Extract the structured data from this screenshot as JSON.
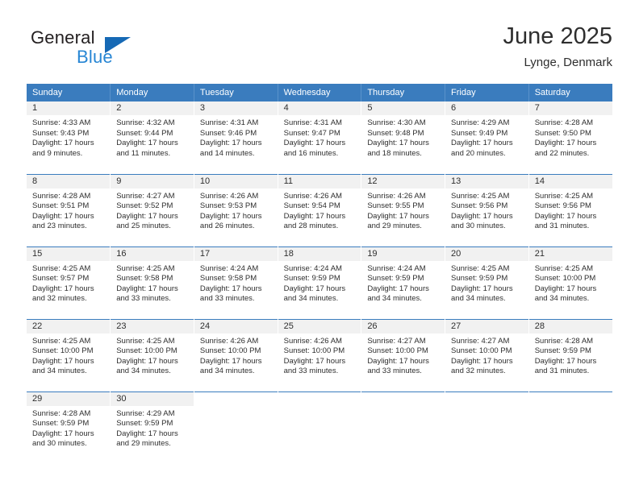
{
  "logo": {
    "word_one": "General",
    "word_two": "Blue",
    "triangle_icon": "blue-triangle-icon",
    "colors": {
      "general": "#231f20",
      "blue": "#2786d4",
      "triangle": "#1669b5"
    }
  },
  "header": {
    "title": "June 2025",
    "subtitle": "Lynge, Denmark"
  },
  "theme": {
    "header_band": "#3a7cbe",
    "daynum_band": "#f1f1f1",
    "text": "#2e2e2e",
    "row_rule": "#3a7cbe"
  },
  "weekday_headers": [
    "Sunday",
    "Monday",
    "Tuesday",
    "Wednesday",
    "Thursday",
    "Friday",
    "Saturday"
  ],
  "labels": {
    "sunrise_prefix": "Sunrise:",
    "sunset_prefix": "Sunset:",
    "daylight_prefix": "Daylight:"
  },
  "weeks": [
    [
      {
        "day": "1",
        "sunrise": "Sunrise: 4:33 AM",
        "sunset": "Sunset: 9:43 PM",
        "daylight_a": "Daylight: 17 hours",
        "daylight_b": "and 9 minutes."
      },
      {
        "day": "2",
        "sunrise": "Sunrise: 4:32 AM",
        "sunset": "Sunset: 9:44 PM",
        "daylight_a": "Daylight: 17 hours",
        "daylight_b": "and 11 minutes."
      },
      {
        "day": "3",
        "sunrise": "Sunrise: 4:31 AM",
        "sunset": "Sunset: 9:46 PM",
        "daylight_a": "Daylight: 17 hours",
        "daylight_b": "and 14 minutes."
      },
      {
        "day": "4",
        "sunrise": "Sunrise: 4:31 AM",
        "sunset": "Sunset: 9:47 PM",
        "daylight_a": "Daylight: 17 hours",
        "daylight_b": "and 16 minutes."
      },
      {
        "day": "5",
        "sunrise": "Sunrise: 4:30 AM",
        "sunset": "Sunset: 9:48 PM",
        "daylight_a": "Daylight: 17 hours",
        "daylight_b": "and 18 minutes."
      },
      {
        "day": "6",
        "sunrise": "Sunrise: 4:29 AM",
        "sunset": "Sunset: 9:49 PM",
        "daylight_a": "Daylight: 17 hours",
        "daylight_b": "and 20 minutes."
      },
      {
        "day": "7",
        "sunrise": "Sunrise: 4:28 AM",
        "sunset": "Sunset: 9:50 PM",
        "daylight_a": "Daylight: 17 hours",
        "daylight_b": "and 22 minutes."
      }
    ],
    [
      {
        "day": "8",
        "sunrise": "Sunrise: 4:28 AM",
        "sunset": "Sunset: 9:51 PM",
        "daylight_a": "Daylight: 17 hours",
        "daylight_b": "and 23 minutes."
      },
      {
        "day": "9",
        "sunrise": "Sunrise: 4:27 AM",
        "sunset": "Sunset: 9:52 PM",
        "daylight_a": "Daylight: 17 hours",
        "daylight_b": "and 25 minutes."
      },
      {
        "day": "10",
        "sunrise": "Sunrise: 4:26 AM",
        "sunset": "Sunset: 9:53 PM",
        "daylight_a": "Daylight: 17 hours",
        "daylight_b": "and 26 minutes."
      },
      {
        "day": "11",
        "sunrise": "Sunrise: 4:26 AM",
        "sunset": "Sunset: 9:54 PM",
        "daylight_a": "Daylight: 17 hours",
        "daylight_b": "and 28 minutes."
      },
      {
        "day": "12",
        "sunrise": "Sunrise: 4:26 AM",
        "sunset": "Sunset: 9:55 PM",
        "daylight_a": "Daylight: 17 hours",
        "daylight_b": "and 29 minutes."
      },
      {
        "day": "13",
        "sunrise": "Sunrise: 4:25 AM",
        "sunset": "Sunset: 9:56 PM",
        "daylight_a": "Daylight: 17 hours",
        "daylight_b": "and 30 minutes."
      },
      {
        "day": "14",
        "sunrise": "Sunrise: 4:25 AM",
        "sunset": "Sunset: 9:56 PM",
        "daylight_a": "Daylight: 17 hours",
        "daylight_b": "and 31 minutes."
      }
    ],
    [
      {
        "day": "15",
        "sunrise": "Sunrise: 4:25 AM",
        "sunset": "Sunset: 9:57 PM",
        "daylight_a": "Daylight: 17 hours",
        "daylight_b": "and 32 minutes."
      },
      {
        "day": "16",
        "sunrise": "Sunrise: 4:25 AM",
        "sunset": "Sunset: 9:58 PM",
        "daylight_a": "Daylight: 17 hours",
        "daylight_b": "and 33 minutes."
      },
      {
        "day": "17",
        "sunrise": "Sunrise: 4:24 AM",
        "sunset": "Sunset: 9:58 PM",
        "daylight_a": "Daylight: 17 hours",
        "daylight_b": "and 33 minutes."
      },
      {
        "day": "18",
        "sunrise": "Sunrise: 4:24 AM",
        "sunset": "Sunset: 9:59 PM",
        "daylight_a": "Daylight: 17 hours",
        "daylight_b": "and 34 minutes."
      },
      {
        "day": "19",
        "sunrise": "Sunrise: 4:24 AM",
        "sunset": "Sunset: 9:59 PM",
        "daylight_a": "Daylight: 17 hours",
        "daylight_b": "and 34 minutes."
      },
      {
        "day": "20",
        "sunrise": "Sunrise: 4:25 AM",
        "sunset": "Sunset: 9:59 PM",
        "daylight_a": "Daylight: 17 hours",
        "daylight_b": "and 34 minutes."
      },
      {
        "day": "21",
        "sunrise": "Sunrise: 4:25 AM",
        "sunset": "Sunset: 10:00 PM",
        "daylight_a": "Daylight: 17 hours",
        "daylight_b": "and 34 minutes."
      }
    ],
    [
      {
        "day": "22",
        "sunrise": "Sunrise: 4:25 AM",
        "sunset": "Sunset: 10:00 PM",
        "daylight_a": "Daylight: 17 hours",
        "daylight_b": "and 34 minutes."
      },
      {
        "day": "23",
        "sunrise": "Sunrise: 4:25 AM",
        "sunset": "Sunset: 10:00 PM",
        "daylight_a": "Daylight: 17 hours",
        "daylight_b": "and 34 minutes."
      },
      {
        "day": "24",
        "sunrise": "Sunrise: 4:26 AM",
        "sunset": "Sunset: 10:00 PM",
        "daylight_a": "Daylight: 17 hours",
        "daylight_b": "and 34 minutes."
      },
      {
        "day": "25",
        "sunrise": "Sunrise: 4:26 AM",
        "sunset": "Sunset: 10:00 PM",
        "daylight_a": "Daylight: 17 hours",
        "daylight_b": "and 33 minutes."
      },
      {
        "day": "26",
        "sunrise": "Sunrise: 4:27 AM",
        "sunset": "Sunset: 10:00 PM",
        "daylight_a": "Daylight: 17 hours",
        "daylight_b": "and 33 minutes."
      },
      {
        "day": "27",
        "sunrise": "Sunrise: 4:27 AM",
        "sunset": "Sunset: 10:00 PM",
        "daylight_a": "Daylight: 17 hours",
        "daylight_b": "and 32 minutes."
      },
      {
        "day": "28",
        "sunrise": "Sunrise: 4:28 AM",
        "sunset": "Sunset: 9:59 PM",
        "daylight_a": "Daylight: 17 hours",
        "daylight_b": "and 31 minutes."
      }
    ],
    [
      {
        "day": "29",
        "sunrise": "Sunrise: 4:28 AM",
        "sunset": "Sunset: 9:59 PM",
        "daylight_a": "Daylight: 17 hours",
        "daylight_b": "and 30 minutes."
      },
      {
        "day": "30",
        "sunrise": "Sunrise: 4:29 AM",
        "sunset": "Sunset: 9:59 PM",
        "daylight_a": "Daylight: 17 hours",
        "daylight_b": "and 29 minutes."
      },
      {
        "day": "",
        "sunrise": "",
        "sunset": "",
        "daylight_a": "",
        "daylight_b": ""
      },
      {
        "day": "",
        "sunrise": "",
        "sunset": "",
        "daylight_a": "",
        "daylight_b": ""
      },
      {
        "day": "",
        "sunrise": "",
        "sunset": "",
        "daylight_a": "",
        "daylight_b": ""
      },
      {
        "day": "",
        "sunrise": "",
        "sunset": "",
        "daylight_a": "",
        "daylight_b": ""
      },
      {
        "day": "",
        "sunrise": "",
        "sunset": "",
        "daylight_a": "",
        "daylight_b": ""
      }
    ]
  ]
}
